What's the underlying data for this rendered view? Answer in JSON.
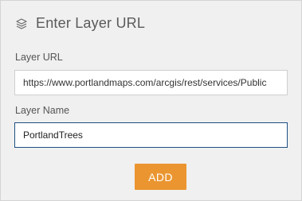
{
  "header": {
    "title": "Enter Layer URL",
    "icon": "layers-icon"
  },
  "layer_url": {
    "label": "Layer URL",
    "value": "https://www.portlandmaps.com/arcgis/rest/services/Public"
  },
  "layer_name": {
    "label": "Layer Name",
    "value": "PortlandTrees"
  },
  "actions": {
    "add_label": "ADD"
  },
  "colors": {
    "accent": "#ea9530",
    "focus_border": "#1f4f80",
    "panel_background": "#f0f0f0"
  }
}
